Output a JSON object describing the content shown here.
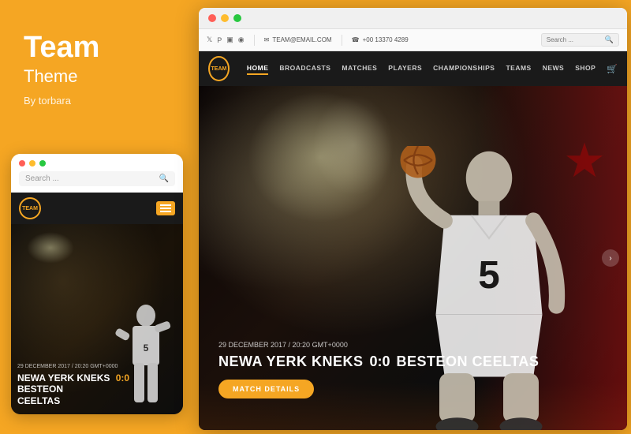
{
  "brand": {
    "title": "Team",
    "subtitle": "Theme",
    "author": "By torbara"
  },
  "mobile": {
    "dots": [
      "red",
      "yellow",
      "green"
    ],
    "search_placeholder": "Search ...",
    "logo_text": "TEAM",
    "date": "29 DECEMBER 2017 / 20:20 GMT+0000",
    "match_line1": "NEWA YERK",
    "match_line2": "KNEKS",
    "score": "0:0",
    "match_line3": "BESTEON",
    "match_line4": "CEELTAS"
  },
  "desktop": {
    "dots": [
      "red",
      "yellow",
      "green"
    ],
    "toolbar": {
      "email_icon": "✉",
      "email": "TEAM@EMAIL.COM",
      "phone_icon": "📞",
      "phone": "+00 13370 4289",
      "search_placeholder": "Search ..."
    },
    "logo_text": "TEAM",
    "nav_items": [
      "HOME",
      "BROADCASTS",
      "MATCHES",
      "PLAYERS",
      "CHAMPIONSHIPS",
      "TEAMS",
      "NEWS",
      "SHOP"
    ],
    "nav_active": "HOME",
    "hero": {
      "date": "29 DECEMBER 2017 / 20:20 GMT+0000",
      "team1": "NEWA YERK KNEKS",
      "score": "0:0",
      "team2": "BESTEON CEELTAS",
      "btn_label": "MATCH DETAILS"
    }
  }
}
